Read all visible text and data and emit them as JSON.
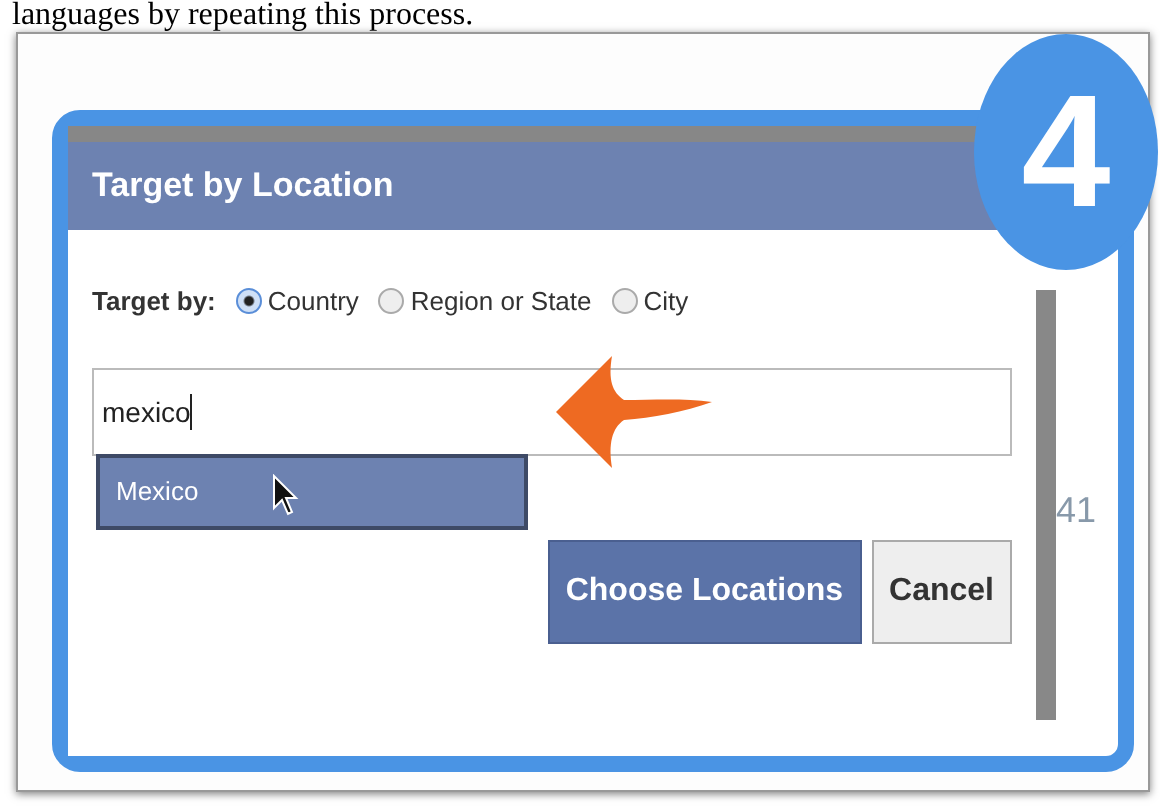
{
  "caption": "languages by repeating this process.",
  "step_badge": "4",
  "dialog": {
    "title": "Target by Location",
    "target_label": "Target by:",
    "options": [
      {
        "label": "Country",
        "selected": true
      },
      {
        "label": "Region or State",
        "selected": false
      },
      {
        "label": "City",
        "selected": false
      }
    ],
    "search": {
      "value": "mexico"
    },
    "suggestions": [
      {
        "label": "Mexico",
        "selected": true
      }
    ],
    "buttons": [
      {
        "label": "Choose Locations",
        "kind": "primary"
      },
      {
        "label": "Cancel",
        "kind": "secondary"
      }
    ]
  },
  "side_number": "41"
}
